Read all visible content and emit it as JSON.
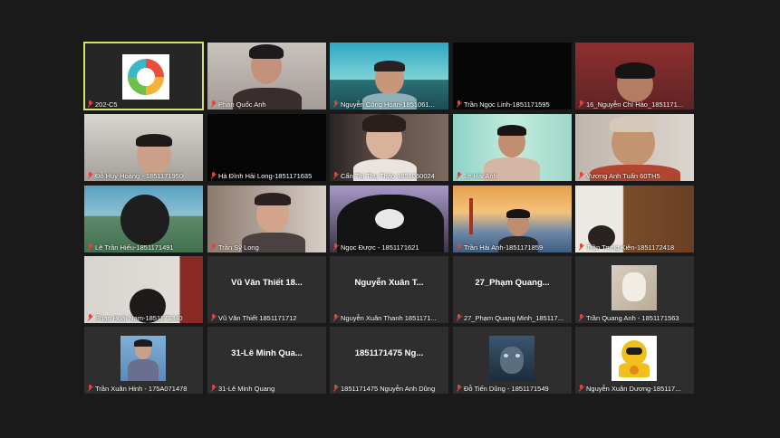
{
  "participants": [
    {
      "name": "202-C5",
      "video": "logo"
    },
    {
      "name": "Phan Quốc Anh",
      "video": "cam"
    },
    {
      "name": "Nguyễn Công Hoan-1851061...",
      "video": "cam"
    },
    {
      "name": "Trần Ngọc Linh-1851171595",
      "video": "off"
    },
    {
      "name": "16_Nguyễn Chí Hào_1851171...",
      "video": "cam"
    },
    {
      "name": "Đỗ Huy Hoàng - 1851171950",
      "video": "cam"
    },
    {
      "name": "Hà Đình Hải Long-1851171635",
      "video": "off"
    },
    {
      "name": "Cấn Thị Thu Thảo 1851060024",
      "video": "cam"
    },
    {
      "name": "Lê Hải Anh",
      "video": "cam"
    },
    {
      "name": "Vương Anh Tuấn 60TH5",
      "video": "cam"
    },
    {
      "name": "Lê Trần Hiếu-1851171491",
      "video": "cam"
    },
    {
      "name": "Trần Sỹ Long",
      "video": "cam"
    },
    {
      "name": "Ngọc Được - 1851171621",
      "video": "cam"
    },
    {
      "name": "Trần Hải Anh-1851171859",
      "video": "cam"
    },
    {
      "name": "Trần Trung Kiên-1851172418",
      "video": "cam"
    },
    {
      "name": "Phan Hoài Nam-1851171340",
      "video": "cam"
    },
    {
      "name": "Vũ Văn Thiết 1851171712",
      "video": "name",
      "display": "Vũ Văn Thiết 18..."
    },
    {
      "name": "Nguyễn Xuân Thanh 1851171...",
      "video": "name",
      "display": "Nguyễn Xuân T..."
    },
    {
      "name": "27_Phạm Quang Minh_185117...",
      "video": "name",
      "display": "27_Phạm Quang..."
    },
    {
      "name": "Trần Quang Anh - 1851171563",
      "video": "avatar"
    },
    {
      "name": "Trần Xuân Hinh - 175A071478",
      "video": "avatar"
    },
    {
      "name": "31-Lê Minh Quang",
      "video": "name",
      "display": "31-Lê Minh Qua..."
    },
    {
      "name": "1851171475 Nguyễn Anh Dũng",
      "video": "name",
      "display": "1851171475 Ng..."
    },
    {
      "name": "Đỗ Tiến Dũng - 1851171549",
      "video": "avatar"
    },
    {
      "name": "Nguyễn Xuân Dương-185117...",
      "video": "avatar"
    }
  ],
  "colors": {
    "background": "#1a1a1a",
    "tile": "#2e2e2e",
    "active_border": "#d6e06a",
    "muted_icon": "#e0443b"
  }
}
